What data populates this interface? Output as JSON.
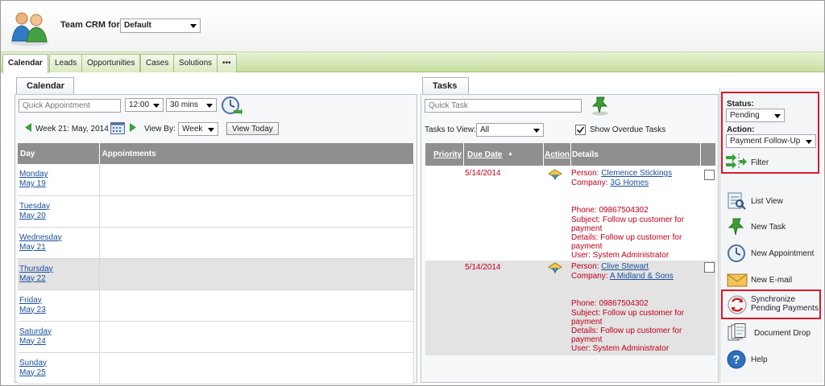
{
  "header": {
    "label": "Team CRM for:",
    "team_select": "Default"
  },
  "tabs": [
    {
      "label": "Calendar"
    },
    {
      "label": "Leads"
    },
    {
      "label": "Opportunities"
    },
    {
      "label": "Cases"
    },
    {
      "label": "Solutions"
    },
    {
      "label": "•••"
    }
  ],
  "calendar": {
    "panel_title": "Calendar",
    "quick_appointment_placeholder": "Quick Appointment",
    "time_select": "12:00",
    "duration_select": "30 mins",
    "week_label": "Week 21: May, 2014",
    "view_by_label": "View By:",
    "view_by_select": "Week",
    "view_today_button": "View Today",
    "columns": {
      "day": "Day",
      "appointments": "Appointments"
    },
    "days": [
      {
        "name": "Monday",
        "date": "May 19"
      },
      {
        "name": "Tuesday",
        "date": "May 20"
      },
      {
        "name": "Wednesday",
        "date": "May 21"
      },
      {
        "name": "Thursday",
        "date": "May 22"
      },
      {
        "name": "Friday",
        "date": "May 23"
      },
      {
        "name": "Saturday",
        "date": "May 24"
      },
      {
        "name": "Sunday",
        "date": "May 25"
      }
    ]
  },
  "tasks": {
    "panel_title": "Tasks",
    "quick_task_placeholder": "Quick Task",
    "tasks_to_view_label": "Tasks to View:",
    "tasks_to_view_select": "All",
    "show_overdue_label": "Show Overdue Tasks",
    "columns": {
      "priority": "Priority",
      "due_date": "Due Date",
      "sort_indicator": "▲",
      "action": "Action",
      "details": "Details"
    },
    "rows": [
      {
        "due_date": "5/14/2014",
        "person_label": "Person:",
        "person": "Clemence Stickings",
        "company_label": "Company:",
        "company": "3G Homes",
        "phone": "Phone:  09867504302",
        "subject_1": "Subject: Follow up customer for",
        "subject_2": "payment",
        "details_1": "Details: Follow up customer for",
        "details_2": "payment",
        "user": "User: System Administrator"
      },
      {
        "due_date": "5/14/2014",
        "person_label": "Person:",
        "person": "Clive Stewart",
        "company_label": "Company:",
        "company": "A Midland & Sons",
        "phone": "Phone:  09867504302",
        "subject_1": "Subject: Follow up customer for",
        "subject_2": "payment",
        "details_1": "Details: Follow up customer for",
        "details_2": "payment",
        "user": "User: System Administrator"
      }
    ]
  },
  "sidebar": {
    "status_label": "Status:",
    "status_select": "Pending",
    "action_label": "Action:",
    "action_select": "Payment Follow-Up",
    "filter_label": "Filter",
    "items": {
      "list_view": "List View",
      "new_task": "New Task",
      "new_appointment": "New Appointment",
      "new_email": "New E-mail",
      "sync_1": "Synchronize",
      "sync_2": "Pending Payments",
      "document_drop": "Document Drop",
      "help": "Help"
    }
  },
  "colors": {
    "accent_red": "#d41b2c",
    "tab_green": "#c8e0a0",
    "grid_header": "#8f8f8f",
    "link_blue": "#1a4f9c",
    "task_red": "#c0001a"
  },
  "icons": {
    "logo": "team-users-icon",
    "clock": "clock-icon",
    "pin": "green-pin-icon",
    "filter": "filter-arrows-icon"
  }
}
